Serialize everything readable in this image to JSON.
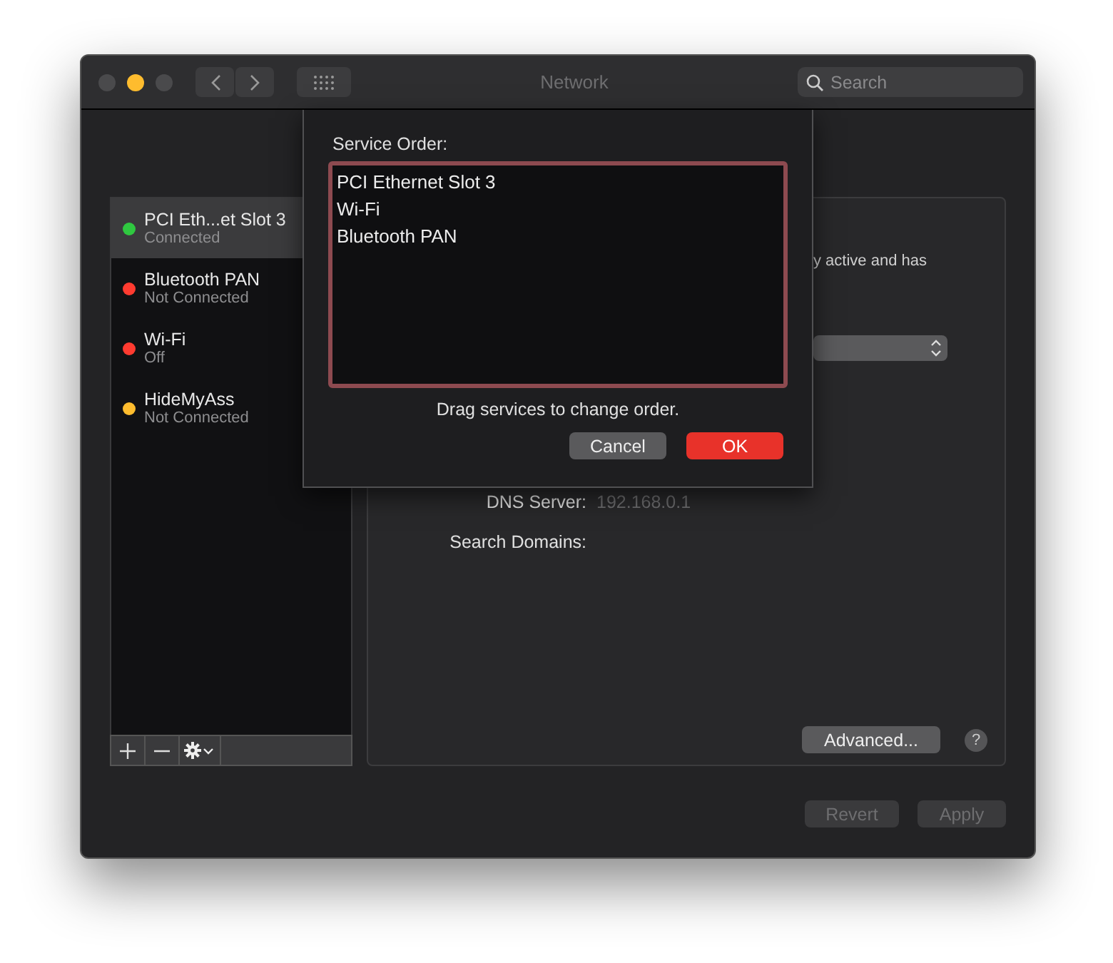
{
  "window": {
    "title": "Network"
  },
  "search": {
    "placeholder": "Search"
  },
  "services": [
    {
      "name": "PCI Eth...et Slot 3",
      "status": "Connected",
      "color": "#2fc840",
      "selected": true
    },
    {
      "name": "Bluetooth PAN",
      "status": "Not Connected",
      "color": "#ff3b30",
      "selected": false
    },
    {
      "name": "Wi-Fi",
      "status": "Off",
      "color": "#ff3b30",
      "selected": false
    },
    {
      "name": "HideMyAss",
      "status": "Not Connected",
      "color": "#febc2e",
      "selected": false
    }
  ],
  "detail": {
    "status_fragment": "y active and has",
    "fields": [
      {
        "label": "DNS Server:",
        "value": "192.168.0.1"
      },
      {
        "label": "Search Domains:"
      }
    ],
    "advanced": "Advanced...",
    "help": "?"
  },
  "footer": [
    {
      "label": "Revert",
      "disabled": true
    },
    {
      "label": "Apply",
      "disabled": true
    }
  ],
  "sheet": {
    "title": "Service Order:",
    "items": [
      "PCI Ethernet Slot 3",
      "Wi-Fi",
      "Bluetooth PAN"
    ],
    "hint": "Drag services to change order.",
    "buttons": [
      {
        "label": "Cancel",
        "kind": "secondary"
      },
      {
        "label": "OK",
        "kind": "primary"
      }
    ]
  }
}
